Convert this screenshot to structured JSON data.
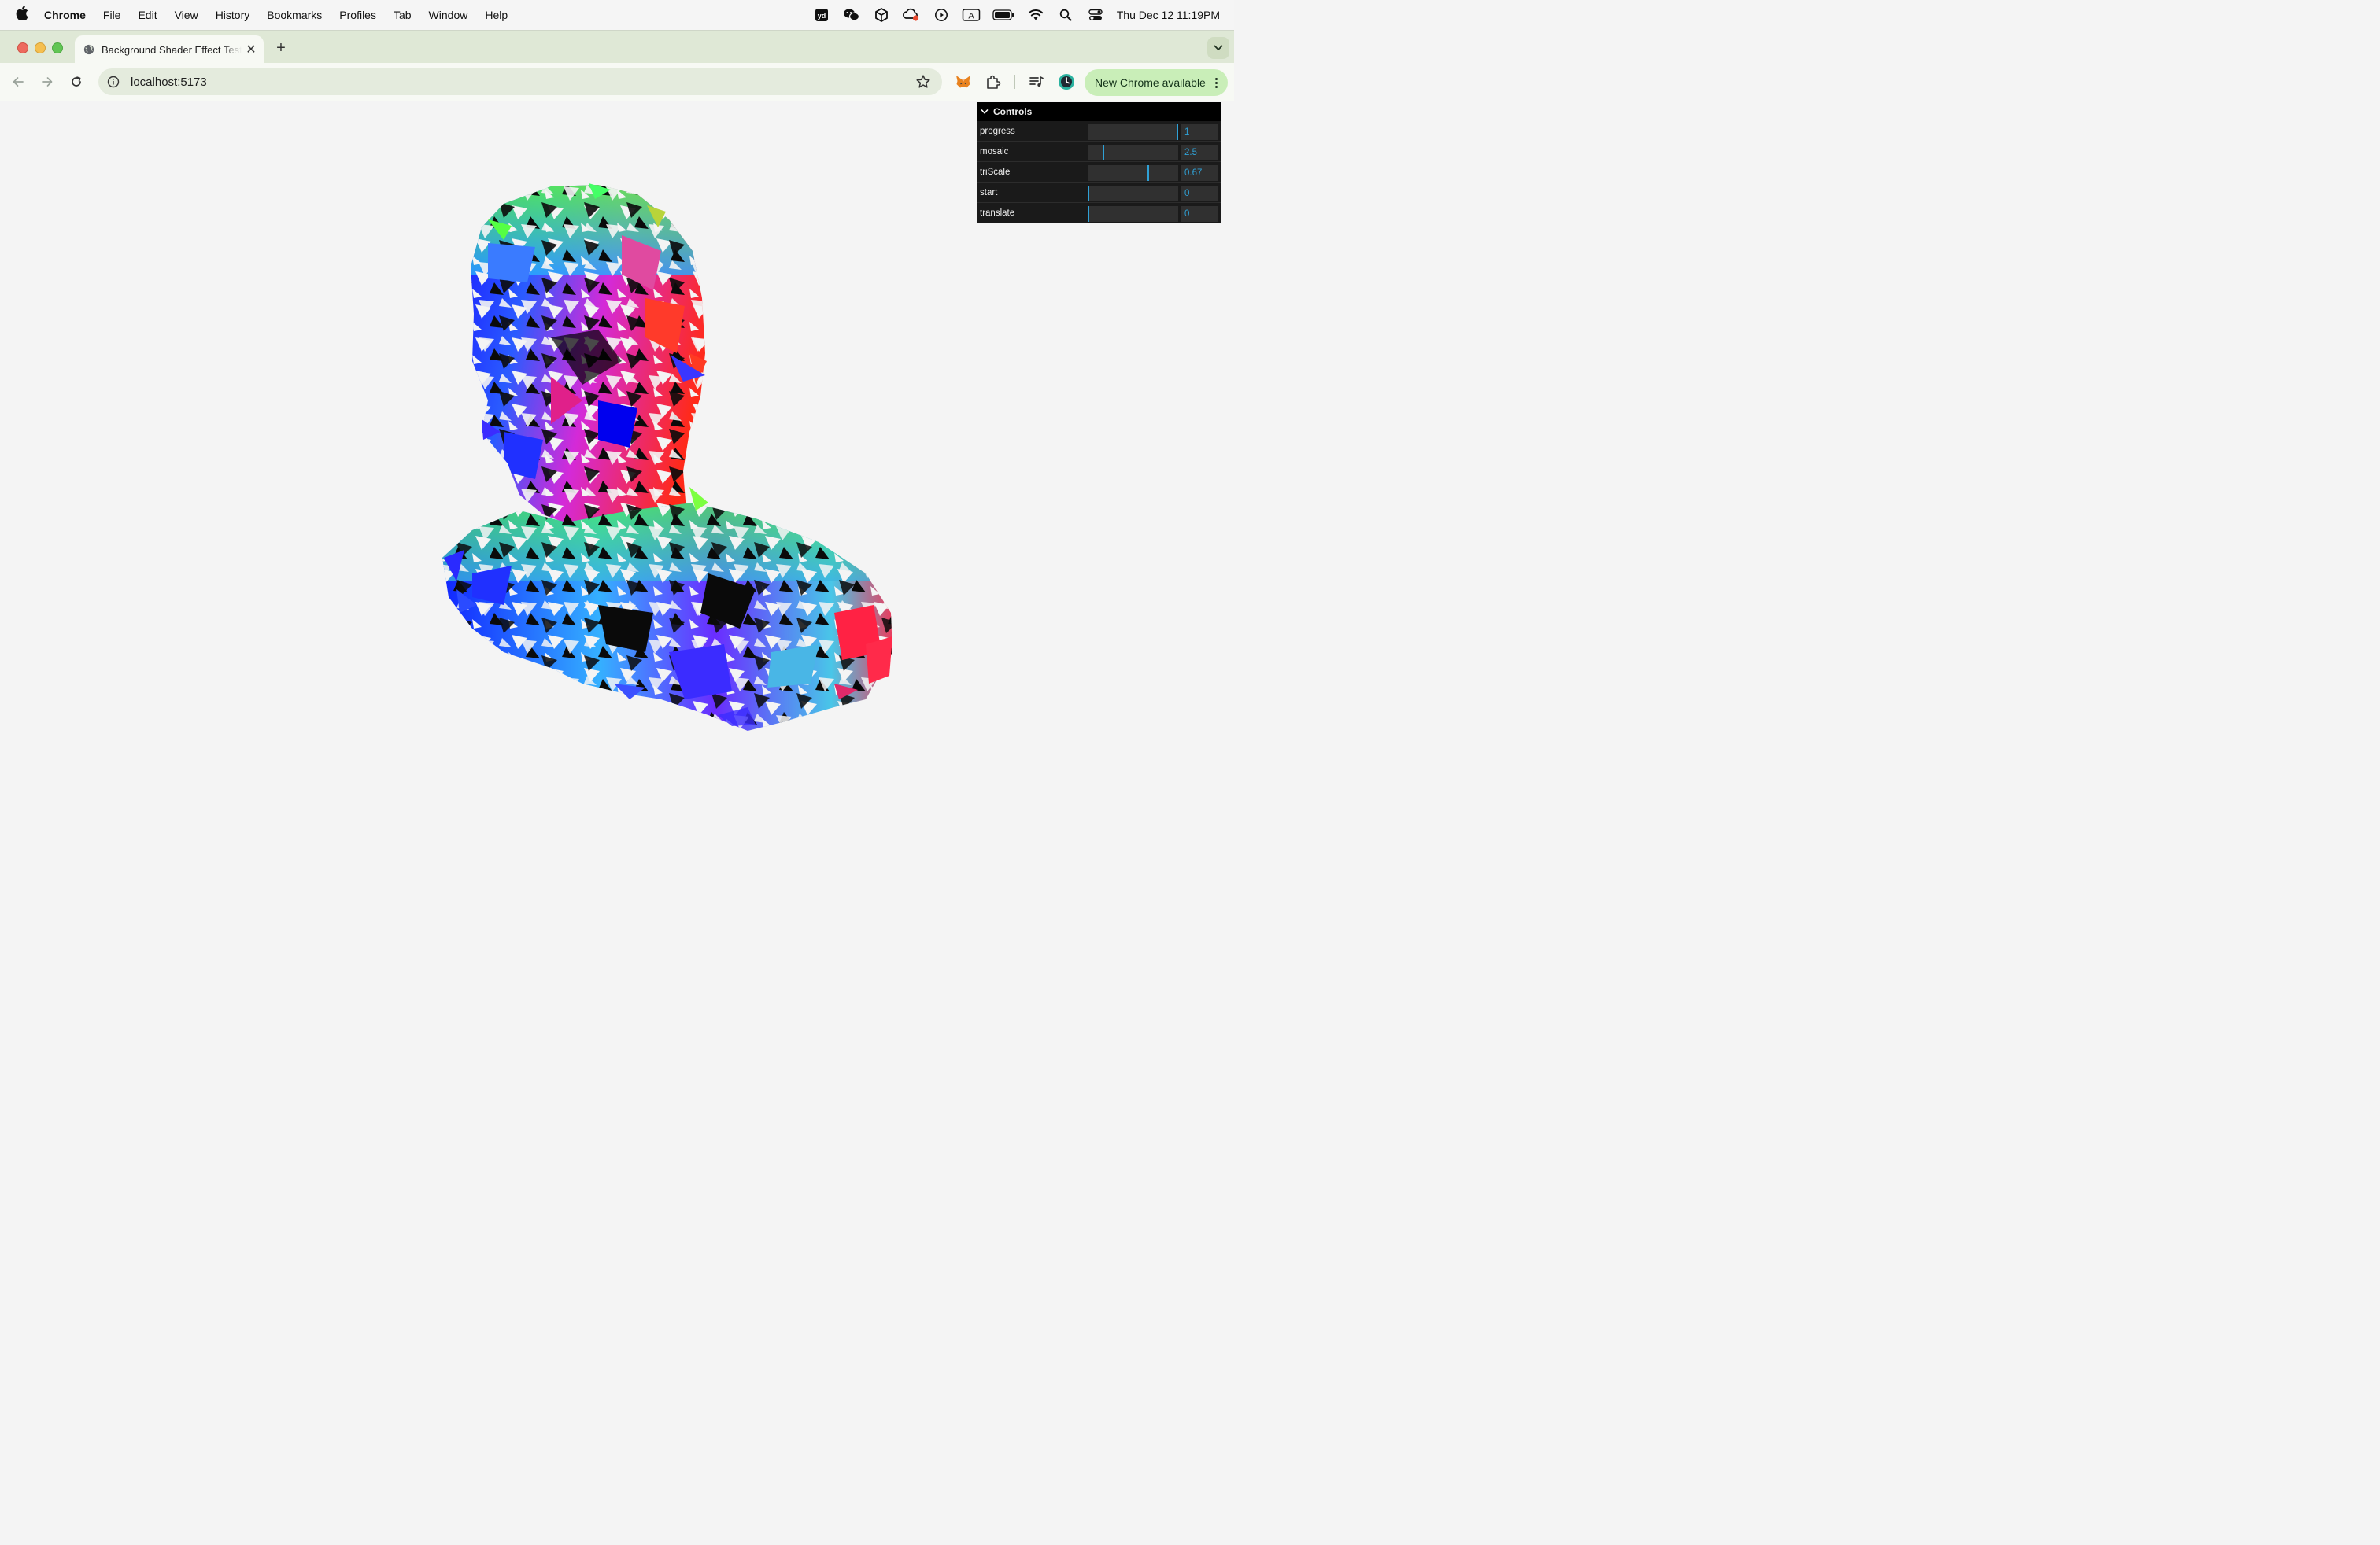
{
  "menubar": {
    "app_name": "Chrome",
    "items": [
      "File",
      "Edit",
      "View",
      "History",
      "Bookmarks",
      "Profiles",
      "Tab",
      "Window",
      "Help"
    ],
    "clock": "Thu Dec 12  11:19PM",
    "status_icons": [
      "youdao-icon",
      "wechat-icon",
      "unity-icon",
      "cloud-sync-icon",
      "play-icon",
      "keyboard-input-icon",
      "battery-icon",
      "wifi-icon",
      "spotlight-search-icon",
      "control-center-icon"
    ]
  },
  "tabs": [
    {
      "title": "Background Shader Effect Test"
    }
  ],
  "toolbar": {
    "url": "localhost:5173",
    "update_label": "New Chrome available"
  },
  "controls": {
    "title": "Controls",
    "params": [
      {
        "label": "progress",
        "value": "1",
        "fraction": 1.0
      },
      {
        "label": "mosaic",
        "value": "2.5",
        "fraction": 0.17
      },
      {
        "label": "triScale",
        "value": "0.67",
        "fraction": 0.67
      },
      {
        "label": "start",
        "value": "0",
        "fraction": 0.0
      },
      {
        "label": "translate",
        "value": "0",
        "fraction": 0.0
      }
    ]
  },
  "colors": {
    "accent": "#2fa1d6",
    "tabstrip_bg": "#dfe8d6",
    "update_pill_bg": "#c9eeb8",
    "page_bg": "#f4f4f4"
  }
}
